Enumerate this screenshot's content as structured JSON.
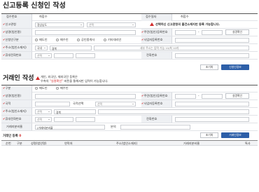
{
  "section1": {
    "title": "신고등록 신청인 작성",
    "rows": {
      "receipt_no_label": "접수번호",
      "receipt_no_value": "취합수",
      "receipt_date_label": "접수일자",
      "receipt_date_value": "취합수",
      "agency_label": "신고관청",
      "agency_value": "경상남도",
      "agency_select": "선택",
      "agency_note": "선택하신 신고관청의 불건소재지만 등록 가능합니다.",
      "name_label": "성명(법인명)",
      "rrn_label": "주민(법인)등록번호",
      "verify_button": "실명확인",
      "applicant_type_label": "신청인구분",
      "applicant_types": [
        "매도인",
        "매수인",
        "공인중개사",
        "기타대리인"
      ],
      "bizno_label": "사업자등록번호",
      "address_label": "주소(법인소재지)",
      "address_country": "국내",
      "address_region": "경북",
      "address_detail_placeholder": "세부 주소는 입력 가능 10/최 10자",
      "mobile_label": "휴대전화번호",
      "mobile_select": "선택",
      "phone_label": "전화번호",
      "reset_button": "초기화",
      "submit_button": "신청인정보"
    }
  },
  "section2": {
    "title": "거래인 작성",
    "notice_line1": "개인, 외국인, 재외국민 등록은",
    "notice_line2_prefix": "우측의 ",
    "notice_link": "\"실명확인\"",
    "notice_line2_suffix": " 버튼을 통해서만 입력이 가능합니다.",
    "rows": {
      "type_label": "구분",
      "type_options": [
        "매도인",
        "매수인"
      ],
      "name_label": "성명(법인명)",
      "rrn_label": "주민(법인)등록번호",
      "verify_button": "실명확인",
      "nationality_label": "국적",
      "nationality_sub": "국적선택",
      "nationality_select": "선택",
      "bizno_label": "사업자등록번호",
      "address_label": "주소(법인소재지)",
      "address_select": "선택",
      "address_region": "경북",
      "mobile_label": "휴대전화번호",
      "mobile_select": "선택",
      "phone_label": "전화번호",
      "share_label": "거래지분비율",
      "share_value": "(거래지분비율",
      "share_unit": "분의",
      "reset_button": "초기화",
      "submit_button": "거래인정보"
    }
  },
  "list": {
    "title": "거래인 등록",
    "count": "0",
    "columns": [
      "순번",
      "구분",
      "성명(법인명)",
      "연락처",
      "주소(법인소재지)",
      "거래지분비율",
      "특사"
    ]
  }
}
